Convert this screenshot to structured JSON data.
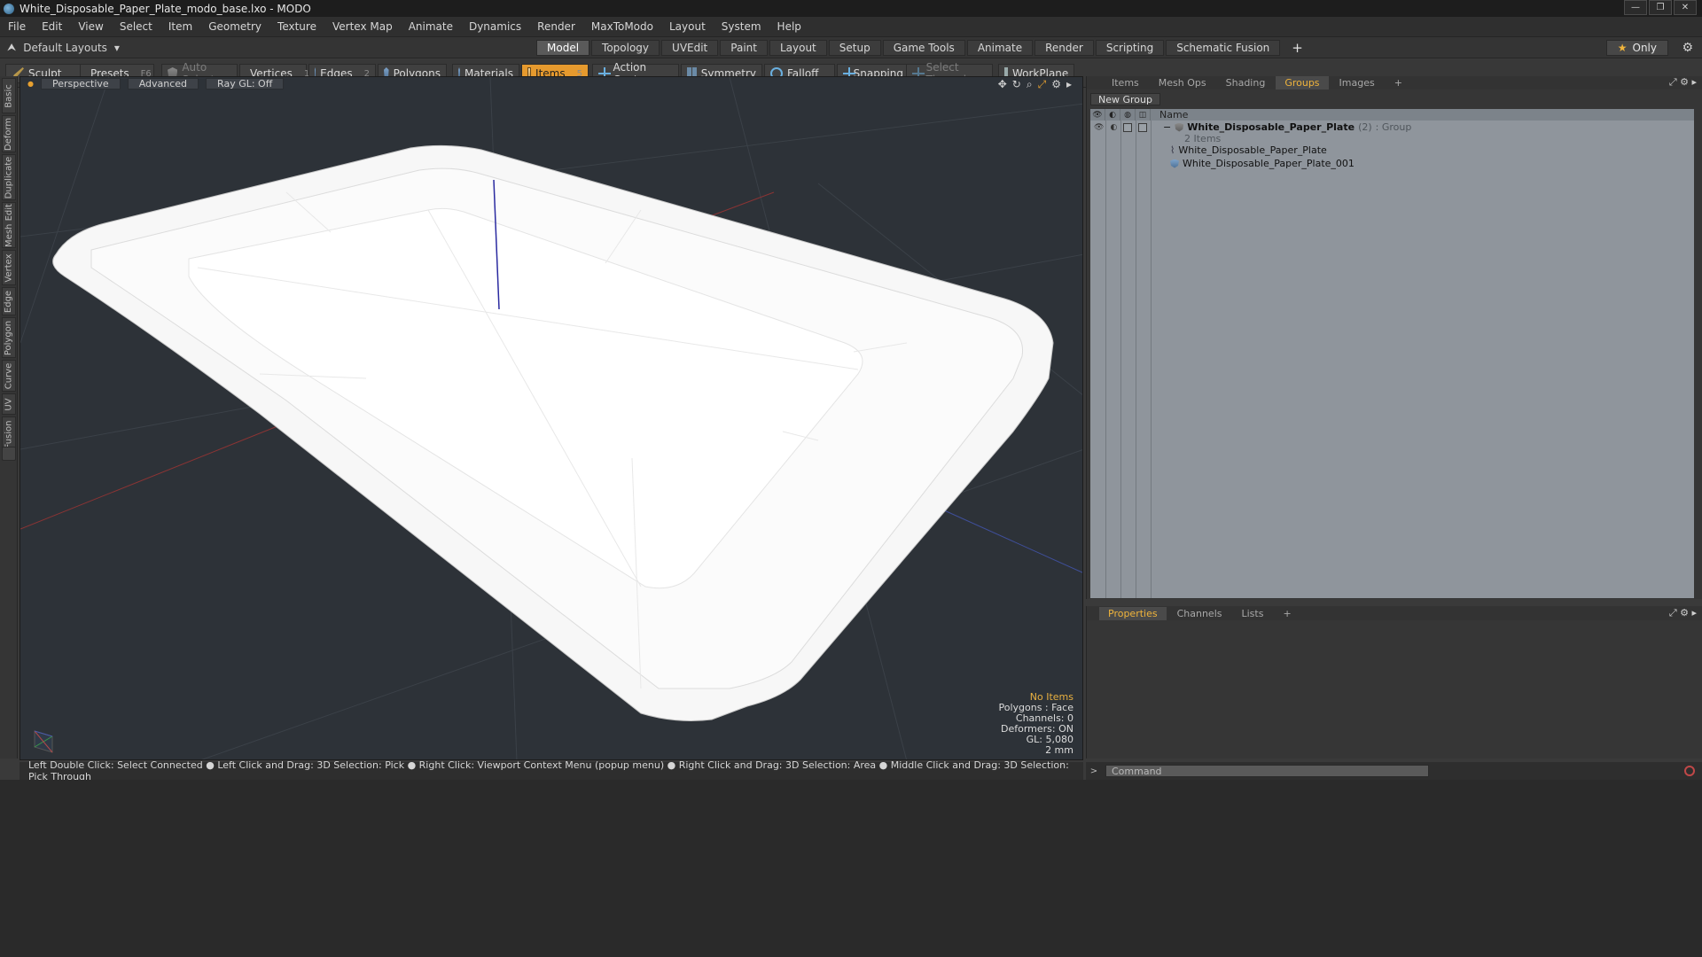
{
  "window": {
    "title": "White_Disposable_Paper_Plate_modo_base.lxo - MODO",
    "controls": [
      "—",
      "❐",
      "✕"
    ]
  },
  "menubar": {
    "items": [
      "File",
      "Edit",
      "View",
      "Select",
      "Item",
      "Geometry",
      "Texture",
      "Vertex Map",
      "Animate",
      "Dynamics",
      "Render",
      "MaxToModo",
      "Layout",
      "System",
      "Help"
    ]
  },
  "layoutbar": {
    "layouts_label": "Default Layouts",
    "tabs": [
      "Model",
      "Topology",
      "UVEdit",
      "Paint",
      "Layout",
      "Setup",
      "Game Tools",
      "Animate",
      "Render",
      "Scripting",
      "Schematic Fusion"
    ],
    "active_tab": "Model",
    "plus": "+",
    "only_label": "Only"
  },
  "toolbar": {
    "sculpt": "Sculpt",
    "presets": "Presets",
    "presets_key": "F6",
    "auto_select": "Auto Select",
    "vertices": "Vertices",
    "vertices_count": "1",
    "edges": "Edges",
    "edges_count": "2",
    "polygons": "Polygons",
    "materials": "Materials",
    "items": "Items",
    "items_count": "5",
    "action_center": "Action Center",
    "symmetry": "Symmetry",
    "falloff": "Falloff",
    "snapping": "Snapping",
    "select_through": "Select Through",
    "workplane": "WorkPlane"
  },
  "sidetabs": [
    "Basic",
    "Deform",
    "Duplicate",
    "Mesh Edit",
    "Vertex",
    "Edge",
    "Polygon",
    "Curve",
    "UV",
    "Fusion"
  ],
  "viewport": {
    "view": "Perspective",
    "mode": "Advanced",
    "raygl": "Ray GL: Off",
    "info": {
      "no_items": "No Items",
      "polygons": "Polygons : Face",
      "channels": "Channels: 0",
      "deformers": "Deformers: ON",
      "gl": "GL: 5,080",
      "scale": "2 mm"
    }
  },
  "right_panel": {
    "tabs": [
      "Items",
      "Mesh Ops",
      "Shading",
      "Groups",
      "Images",
      "+"
    ],
    "active_tab": "Groups",
    "new_group": "New Group",
    "name_header": "Name",
    "group": {
      "name": "White_Disposable_Paper_Plate",
      "count": "(2)",
      "type": ": Group",
      "subtitle": "2 Items",
      "children": [
        "White_Disposable_Paper_Plate",
        "White_Disposable_Paper_Plate_001"
      ]
    }
  },
  "properties_panel": {
    "tabs": [
      "Properties",
      "Channels",
      "Lists",
      "+"
    ],
    "active_tab": "Properties"
  },
  "statusbar": {
    "text": "Left Double Click: Select Connected ● Left Click and Drag: 3D Selection: Pick ● Right Click: Viewport Context Menu (popup menu) ● Right Click and Drag: 3D Selection: Area ● Middle Click and Drag: 3D Selection: Pick Through"
  },
  "command": {
    "placeholder": "Command"
  },
  "colors": {
    "accent": "#e69a2e",
    "active_tab_text": "#f0b43c",
    "viewport_bg": "#2d3238"
  }
}
